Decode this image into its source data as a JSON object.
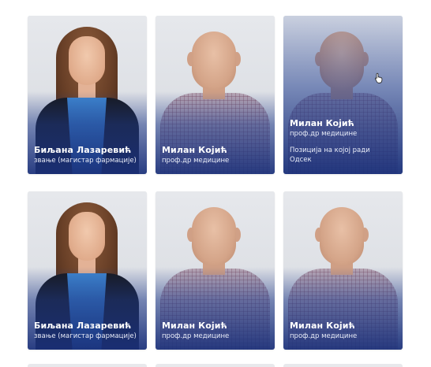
{
  "cards": [
    {
      "name": "Биљана Лазаревић",
      "title": "звање (магистар фармације)"
    },
    {
      "name": "Милан Којић",
      "title": "проф.др медицине"
    },
    {
      "name": "Милан Којић",
      "title": "проф.др медицине",
      "position": "Позиција на којој ради",
      "department": "Одсек"
    },
    {
      "name": "Биљана Лазаревић",
      "title": "звање (магистар фармације)"
    },
    {
      "name": "Милан Којић",
      "title": "проф.др медицине"
    },
    {
      "name": "Милан Којић",
      "title": "проф.др медицине"
    }
  ],
  "cursor": "hand-pointer-icon",
  "colors": {
    "overlay": "#1a307a"
  }
}
